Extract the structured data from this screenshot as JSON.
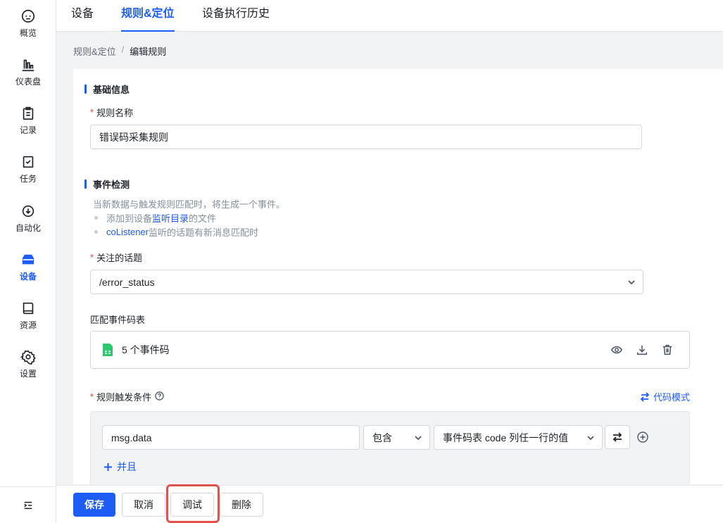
{
  "sidebar": {
    "items": [
      {
        "label": "概览",
        "icon": "robot-icon"
      },
      {
        "label": "仪表盘",
        "icon": "bar-chart-icon"
      },
      {
        "label": "记录",
        "icon": "clipboard-icon"
      },
      {
        "label": "任务",
        "icon": "task-icon"
      },
      {
        "label": "自动化",
        "icon": "automation-icon"
      },
      {
        "label": "设备",
        "icon": "device-icon",
        "active": true
      },
      {
        "label": "资源",
        "icon": "book-icon"
      },
      {
        "label": "设置",
        "icon": "gear-icon"
      }
    ]
  },
  "tabs": [
    {
      "label": "设备"
    },
    {
      "label": "规则&定位",
      "active": true
    },
    {
      "label": "设备执行历史"
    }
  ],
  "breadcrumb": {
    "parent": "规则&定位",
    "separator": "/",
    "current": "编辑规则"
  },
  "basic": {
    "title": "基础信息",
    "name_label": "规则名称",
    "name_value": "错误码采集规则"
  },
  "event": {
    "title": "事件检测",
    "description": "当新数据与触发规则匹配时，将生成一个事件。",
    "bullet1_pre": "添加到设备",
    "bullet1_link": "监听目录",
    "bullet1_post": "的文件",
    "bullet2_link": "coListener",
    "bullet2_post": "监听的话题有新消息匹配时",
    "topic_label": "关注的话题",
    "topic_value": "/error_status",
    "codes_label": "匹配事件码表",
    "codes_value": "5 个事件码",
    "cond_label": "规则触发条件",
    "code_mode": "代码模式",
    "cond_field": "msg.data",
    "cond_op": "包含",
    "cond_value": "事件码表 code 列任一行的值",
    "and_label": "并且"
  },
  "footer": {
    "save": "保存",
    "cancel": "取消",
    "debug": "调试",
    "delete": "删除"
  },
  "colors": {
    "accent": "#1d5cf5",
    "required": "#f53f3f",
    "highlight": "#e0524c",
    "file_icon": "#2fc76e"
  }
}
